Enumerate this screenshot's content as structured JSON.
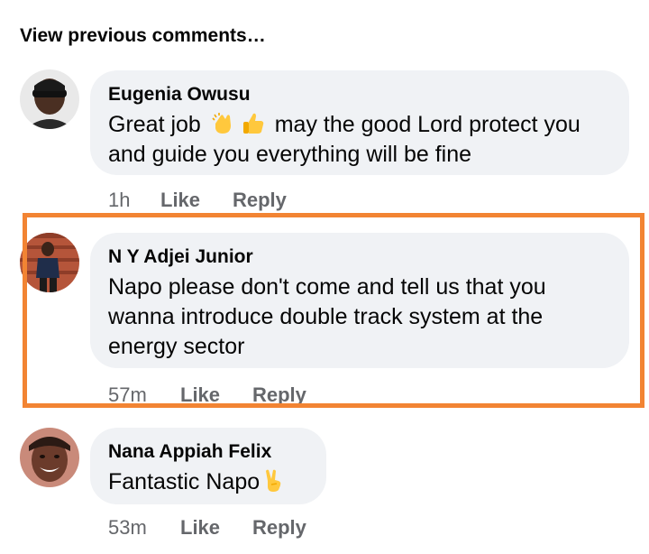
{
  "view_previous": "View previous comments…",
  "colors": {
    "highlight": "#f28433",
    "bubble": "#f0f2f5",
    "meta_text": "#65676b"
  },
  "comments": [
    {
      "author": "Eugenia Owusu",
      "text_before": "Great job ",
      "emojis": [
        "clapping-hands-emoji",
        "thumbs-up-emoji"
      ],
      "text_after": " may the good Lord protect you and guide you everything will be fine",
      "time": "1h",
      "like": "Like",
      "reply": "Reply"
    },
    {
      "author": "N Y Adjei Junior",
      "text": "Napo please don't come and tell us that you wanna introduce double track system at the energy sector",
      "time": "57m",
      "like": "Like",
      "reply": "Reply",
      "highlighted": true
    },
    {
      "author": "Nana Appiah Felix",
      "text_before": "Fantastic Napo",
      "emojis": [
        "victory-hand-emoji"
      ],
      "time": "53m",
      "like": "Like",
      "reply": "Reply"
    }
  ]
}
